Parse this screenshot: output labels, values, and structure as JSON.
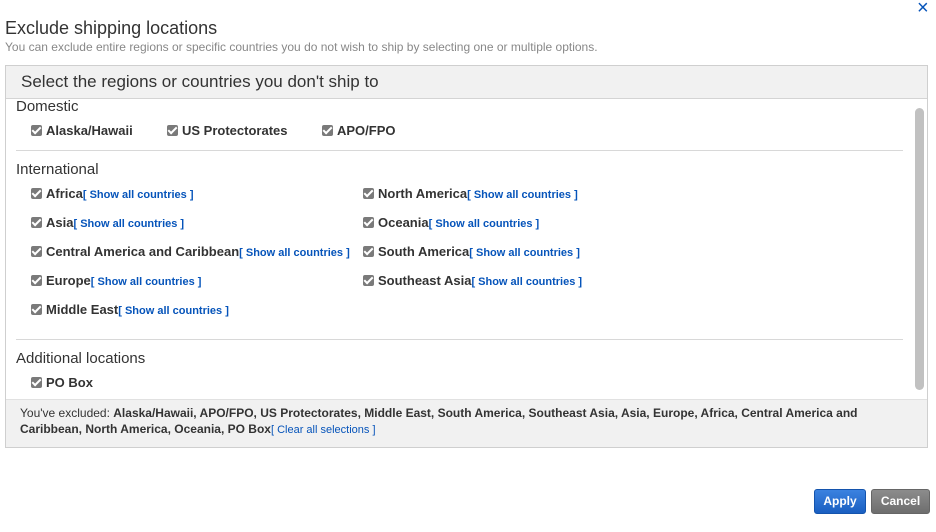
{
  "dialog": {
    "close_glyph": "×",
    "title": "Exclude shipping locations",
    "subtitle": "You can exclude entire regions or specific countries you do not wish to ship by selecting one or multiple options."
  },
  "panel": {
    "heading": "Select the regions or countries you don't ship to",
    "show_all_label": "[ Show all countries ]",
    "domestic": {
      "title": "Domestic",
      "options": [
        {
          "label": "Alaska/Hawaii",
          "checked": true
        },
        {
          "label": "US Protectorates",
          "checked": true
        },
        {
          "label": "APO/FPO",
          "checked": true
        }
      ]
    },
    "international": {
      "title": "International",
      "options": [
        {
          "label": "Africa",
          "checked": true
        },
        {
          "label": "Asia",
          "checked": true
        },
        {
          "label": "Central America and Caribbean",
          "checked": true
        },
        {
          "label": "Europe",
          "checked": true
        },
        {
          "label": "Middle East",
          "checked": true
        },
        {
          "label": "North America",
          "checked": true
        },
        {
          "label": "Oceania",
          "checked": true
        },
        {
          "label": "South America",
          "checked": true
        },
        {
          "label": "Southeast Asia",
          "checked": true
        }
      ]
    },
    "additional": {
      "title": "Additional locations",
      "options": [
        {
          "label": "PO Box",
          "checked": true
        }
      ]
    },
    "summary": {
      "prefix": "You've excluded: ",
      "list": "Alaska/Hawaii, APO/FPO, US Protectorates, Middle East, South America, Southeast Asia, Asia, Europe, Africa, Central America and Caribbean, North America, Oceania, PO Box",
      "clear_label": "[ Clear all selections ]"
    }
  },
  "buttons": {
    "apply": "Apply",
    "cancel": "Cancel"
  },
  "colors": {
    "link": "#0654ba",
    "apply_bg": "#1a5fc1",
    "cancel_bg": "#6e6e6e",
    "checkbox": "#7a7a7a"
  }
}
